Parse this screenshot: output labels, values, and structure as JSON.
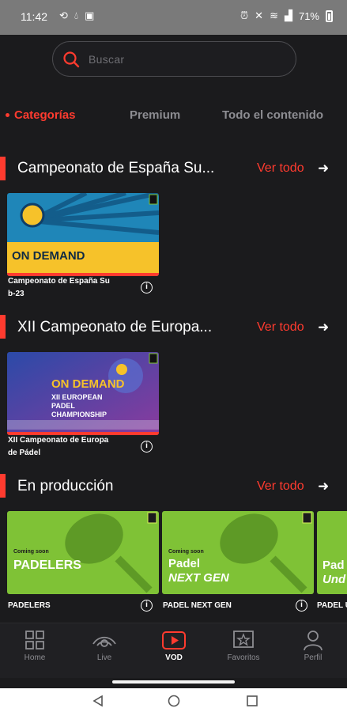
{
  "statusbar": {
    "time": "11:42",
    "battery": "71%"
  },
  "search": {
    "placeholder": "Buscar"
  },
  "tabs": [
    {
      "label": "Categorías",
      "active": true
    },
    {
      "label": "Premium",
      "active": false
    },
    {
      "label": "Todo el contenido",
      "active": false
    }
  ],
  "sections": [
    {
      "title": "Campeonato de España Su...",
      "see_all": "Ver todo",
      "items": [
        {
          "caption": [
            "Campeonato de España Su",
            "b-23"
          ],
          "banner": "ON DEMAND"
        }
      ]
    },
    {
      "title": "XII Campeonato de Europa...",
      "see_all": "Ver todo",
      "items": [
        {
          "caption": [
            "XII Campeonato de Europa",
            "de Pádel"
          ],
          "banner": "ON DEMAND",
          "subbanner": "XII EUROPEAN PADEL CHAMPIONSHIP"
        }
      ]
    },
    {
      "title": "En producción",
      "see_all": "Ver todo",
      "items": [
        {
          "caption": [
            "PADELERS"
          ],
          "kicker": "Coming soon",
          "banner": "PADELERS"
        },
        {
          "caption": [
            "PADEL NEXT GEN"
          ],
          "kicker": "Coming soon",
          "banner": "Padel",
          "banner2": "NEXT GEN"
        },
        {
          "caption": [
            "PADEL U"
          ],
          "banner": "Pad",
          "banner2": "Und"
        }
      ]
    }
  ],
  "nav": [
    {
      "label": "Home",
      "icon": "grid-icon",
      "active": false
    },
    {
      "label": "Live",
      "icon": "live-icon",
      "active": false
    },
    {
      "label": "VOD",
      "icon": "play-icon",
      "active": true
    },
    {
      "label": "Favoritos",
      "icon": "star-icon",
      "active": false
    },
    {
      "label": "Perfil",
      "icon": "user-icon",
      "active": false
    }
  ],
  "colors": {
    "accent": "#ff3b2f",
    "background": "#1b1b1d",
    "green": "#7fc236",
    "yellow": "#f6c22a",
    "blue": "#2a76b7"
  }
}
